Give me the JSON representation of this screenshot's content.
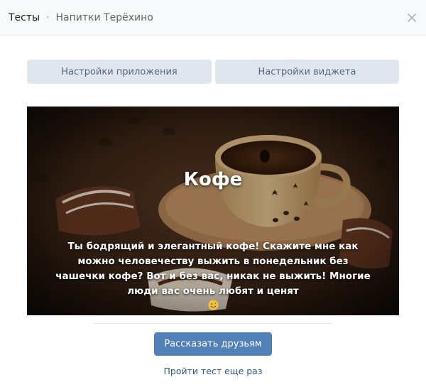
{
  "header": {
    "breadcrumb_root": "Тесты",
    "breadcrumb_separator": "·",
    "breadcrumb_current": "Напитки Терёхино",
    "close_icon": "close-icon"
  },
  "settings_buttons": {
    "app_settings_label": "Настройки приложения",
    "widget_settings_label": "Настройки виджета"
  },
  "result": {
    "title": "Кофе",
    "description": "Ты бодрящий и элегантный кофе! Скажите мне как можно человечеству выжить в понедельник без чашечки кофе? Вот и без вас, никак не выжить! Многие люди вас очень любят и ценят",
    "emoji_icon": "smiling-face-emoji-icon",
    "image_icon": "coffee-cup-photo"
  },
  "actions": {
    "share_label": "Рассказать друзьям",
    "retry_label": "Пройти тест еще раз"
  },
  "colors": {
    "accent": "#5181b8",
    "link": "#2a5885",
    "secondary_button_bg": "#dfe6ee",
    "secondary_button_text": "#55677d"
  }
}
